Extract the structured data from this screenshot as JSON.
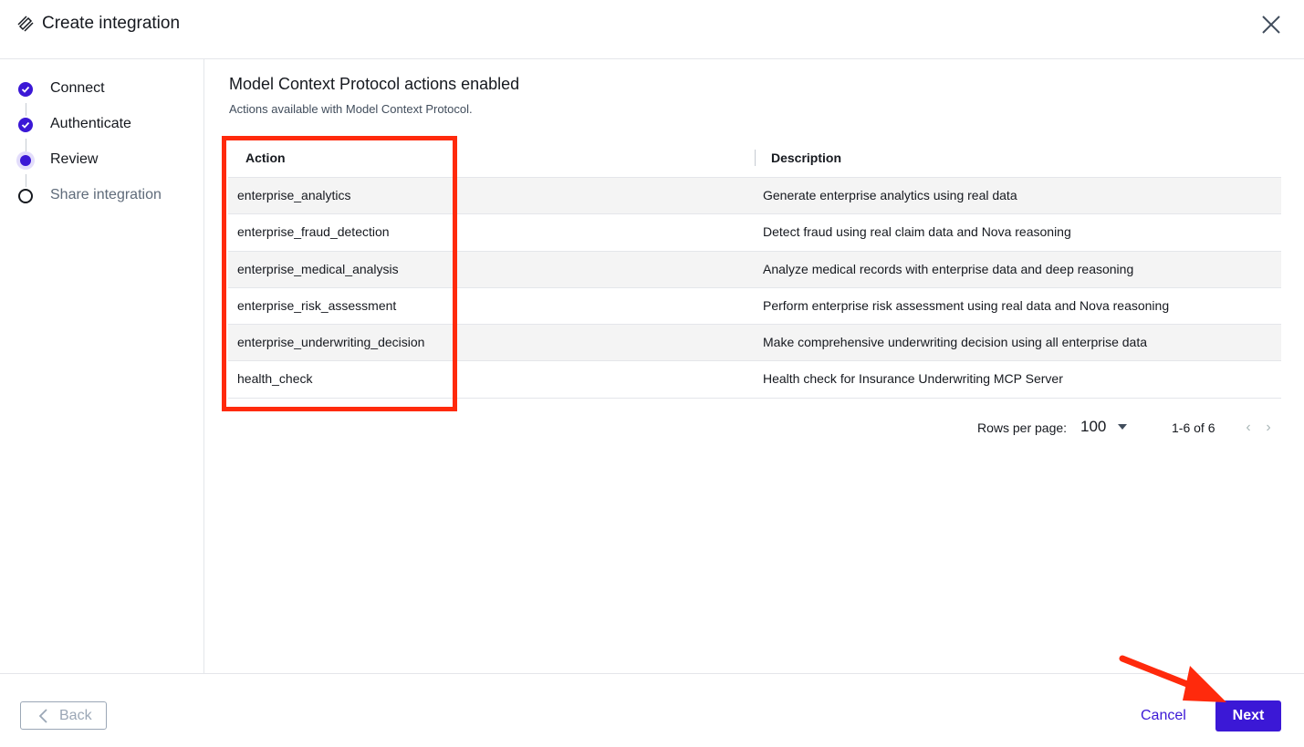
{
  "header": {
    "title": "Create integration",
    "logo_icon": "pencil-ruler-icon",
    "close_icon": "close-icon"
  },
  "steps": [
    {
      "label": "Connect",
      "status": "done"
    },
    {
      "label": "Authenticate",
      "status": "done"
    },
    {
      "label": "Review",
      "status": "current"
    },
    {
      "label": "Share integration",
      "status": "todo"
    }
  ],
  "main": {
    "title": "Model Context Protocol actions enabled",
    "subtitle": "Actions available with Model Context Protocol."
  },
  "table": {
    "headers": {
      "action": "Action",
      "description": "Description"
    },
    "rows": [
      {
        "action": "enterprise_analytics",
        "description": "Generate enterprise analytics using real data"
      },
      {
        "action": "enterprise_fraud_detection",
        "description": "Detect fraud using real claim data and Nova reasoning"
      },
      {
        "action": "enterprise_medical_analysis",
        "description": "Analyze medical records with enterprise data and deep reasoning"
      },
      {
        "action": "enterprise_risk_assessment",
        "description": "Perform enterprise risk assessment using real data and Nova reasoning"
      },
      {
        "action": "enterprise_underwriting_decision",
        "description": "Make comprehensive underwriting decision using all enterprise data"
      },
      {
        "action": "health_check",
        "description": "Health check for Insurance Underwriting MCP Server"
      }
    ]
  },
  "pagination": {
    "rows_per_page_label": "Rows per page:",
    "rows_per_page_value": "100",
    "range": "1-6 of 6"
  },
  "footer": {
    "back_label": "Back",
    "cancel_label": "Cancel",
    "next_label": "Next"
  },
  "colors": {
    "accent": "#3b18d6",
    "annotation": "#ff2a0c"
  }
}
